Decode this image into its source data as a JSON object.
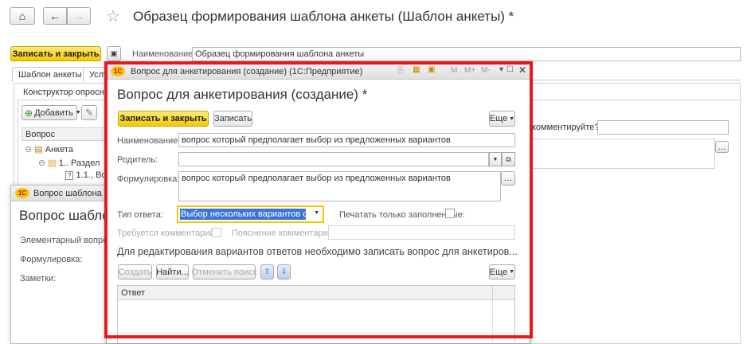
{
  "main": {
    "title": "Образец формирования шаблона анкеты (Шаблон анкеты) *",
    "save_close": "Записать и закрыть",
    "name_label": "Наименование:",
    "name_value": "Образец формирования шаблона анкеты",
    "tab_template": "Шаблон анкеты",
    "tab_services": "Услу",
    "constructor_label": "Конструктор опросник",
    "add_button": "Добавить",
    "tree_header": "Вопрос",
    "tree_items": [
      "Анкета",
      "1.. Раздел",
      "1.1., Во"
    ],
    "comment_label": "комментируйте?:"
  },
  "bg_window": {
    "title": "Вопрос шаблона анк",
    "heading": "Вопрос шабло",
    "elementary_label": "Элементарный вопрос:",
    "wording_label": "Формулировка:",
    "notes_label": "Заметки:"
  },
  "dialog": {
    "titlebar": "Вопрос для анкетирования (создание) (1С:Предприятие)",
    "heading": "Вопрос для анкетирования (создание) *",
    "save_close": "Записать и закрыть",
    "save": "Записать",
    "more": "Еще",
    "name_label": "Наименование:",
    "name_value": "вопрос который предполагает выбор из предложенных вариантов",
    "parent_label": "Родитель:",
    "parent_value": "",
    "wording_label": "Формулировка:",
    "wording_value": "вопрос который предполагает выбор из предложенных вариантов",
    "answer_type_label": "Тип ответа:",
    "answer_type_value": "Выбор нескольких вариантов ответ",
    "print_filled_label": "Печатать только заполненные:",
    "comment_required_label": "Требуется комментарий:",
    "comment_explain_label": "Пояснение комментария:",
    "info_text": "Для редактирования вариантов ответов необходимо записать вопрос для анкетиров...",
    "create": "Создать",
    "find": "Найти...",
    "cancel_search": "Отменить поиск",
    "more2": "Еще",
    "table_header_answer": "Ответ"
  },
  "colors": {
    "highlight_border": "#e21b23",
    "yellow_button": "#f4c900",
    "selection": "#3875d7"
  }
}
